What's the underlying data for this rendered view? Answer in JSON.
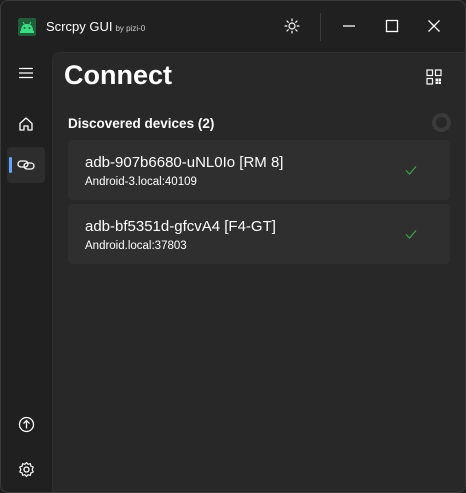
{
  "window": {
    "title": "Scrcpy GUI",
    "subtitle": "by pizi-0"
  },
  "titlebar": {
    "icons": [
      "theme-toggle-icon",
      "minimize-icon",
      "maximize-icon",
      "close-icon"
    ]
  },
  "nav": {
    "items": [
      {
        "name": "menu",
        "icon": "hamburger-menu-icon"
      },
      {
        "name": "home",
        "icon": "home-icon"
      },
      {
        "name": "connect",
        "icon": "link-icon",
        "active": true
      },
      {
        "name": "update",
        "icon": "arrow-up-circle-icon"
      },
      {
        "name": "settings",
        "icon": "gear-icon"
      }
    ]
  },
  "main": {
    "title": "Connect",
    "section_title": "Discovered devices (2)",
    "devices": [
      {
        "name": "adb-907b6680-uNL0Io [RM 8]",
        "address": "Android-3.local:40109",
        "connected": true
      },
      {
        "name": "adb-bf5351d-gfcvA4 [F4-GT]",
        "address": "Android.local:37803",
        "connected": true
      }
    ]
  },
  "colors": {
    "background": "#202020",
    "content": "#282828",
    "card": "#2f2f2f",
    "accent": "#60a5fa",
    "check": "#3fa34d",
    "app_icon": "#3ddc84"
  }
}
